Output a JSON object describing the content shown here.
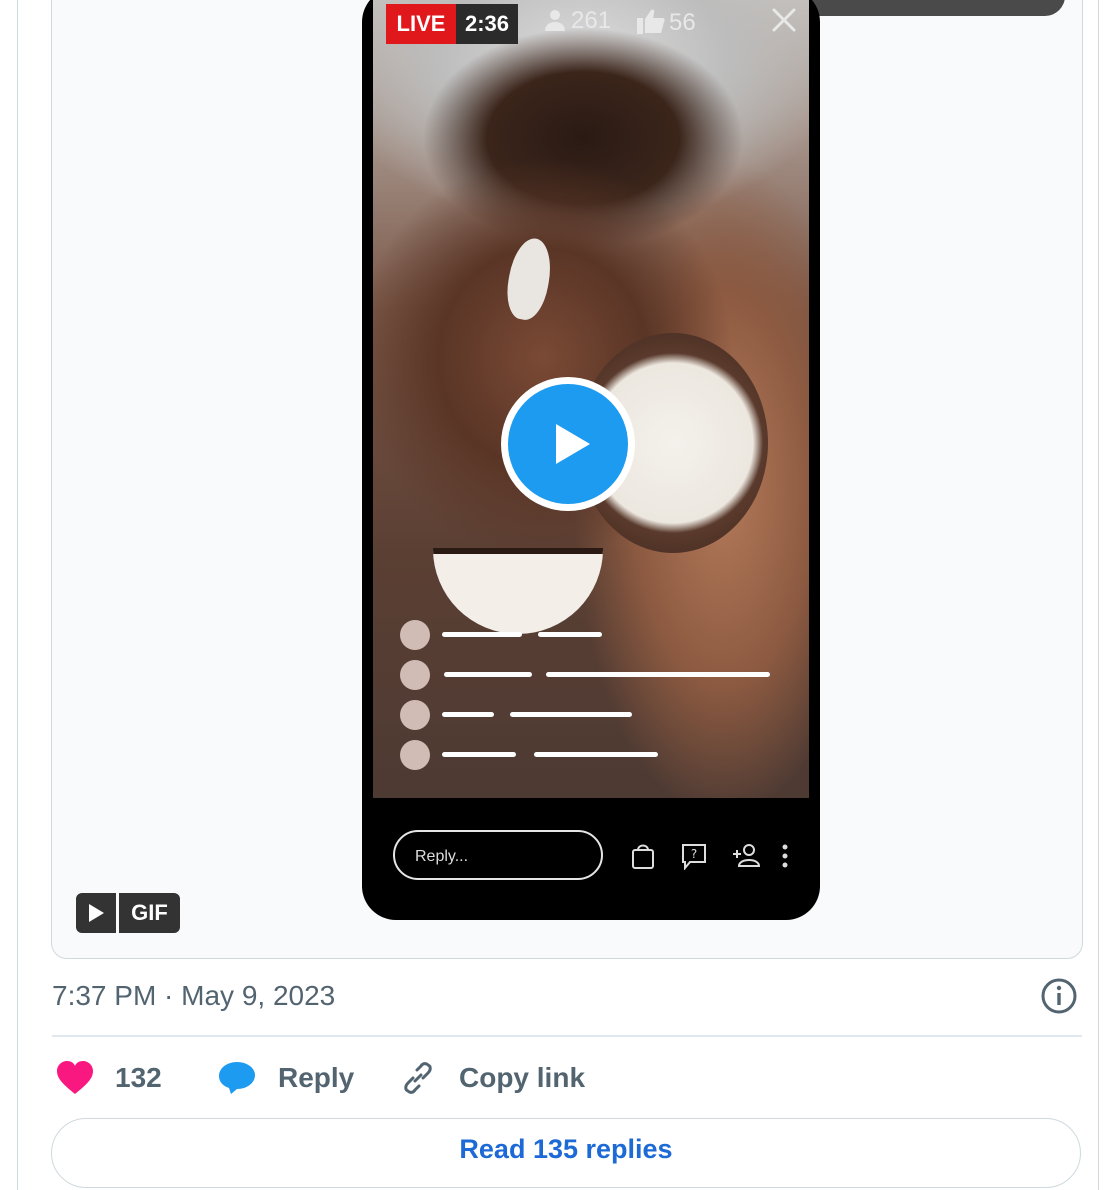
{
  "stream": {
    "live_label": "LIVE",
    "duration": "2:36",
    "viewers": "261",
    "likes": "56",
    "reply_placeholder": "Reply..."
  },
  "media": {
    "gif_label": "GIF"
  },
  "tweet": {
    "timestamp": "7:37 PM · May 9, 2023",
    "like_count": "132",
    "reply_label": "Reply",
    "copy_link_label": "Copy link",
    "read_replies_label": "Read 135 replies"
  },
  "colors": {
    "live_red": "#e0171b",
    "play_blue": "#1d9bf0",
    "like_pink": "#f91880",
    "link_blue": "#1d6ad6"
  },
  "icons": [
    "person-icon",
    "thumbs-up-icon",
    "close-icon",
    "play-icon",
    "shopping-bag-icon",
    "question-icon",
    "add-person-icon",
    "more-icon",
    "info-icon",
    "heart-icon",
    "reply-bubble-icon",
    "link-icon"
  ]
}
